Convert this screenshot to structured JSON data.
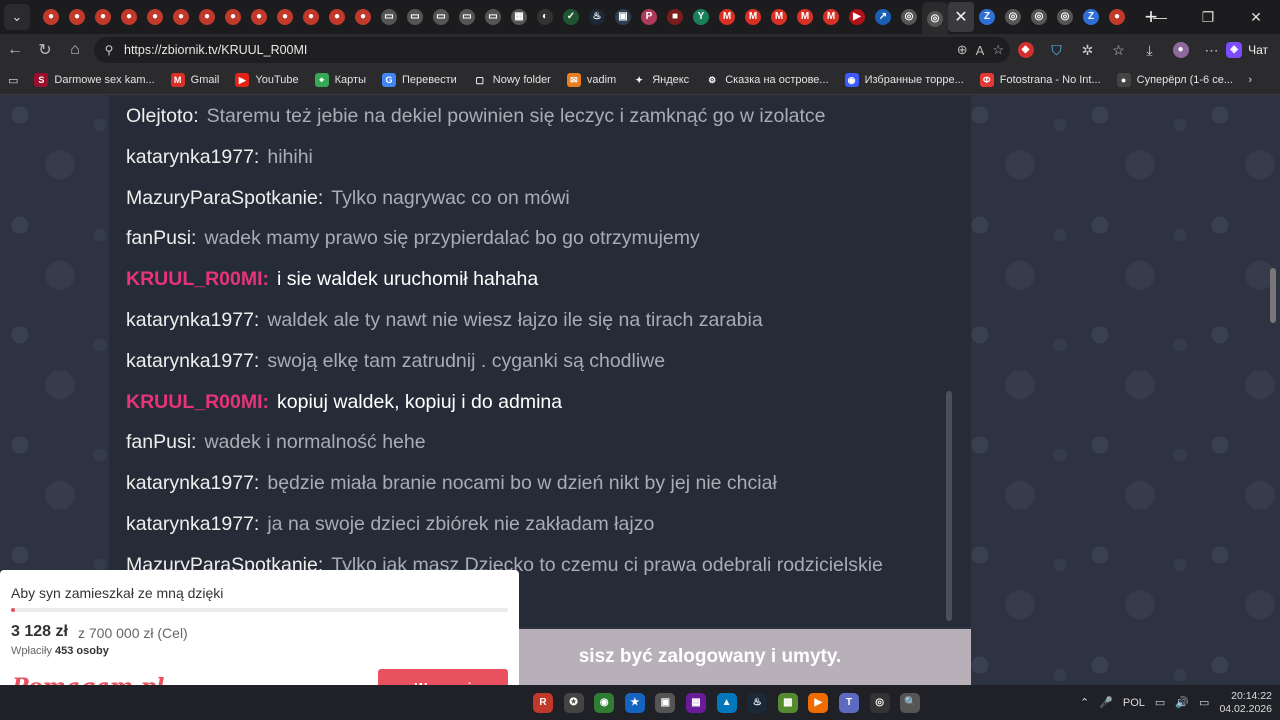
{
  "browser": {
    "tab_favicons": [
      {
        "icon": "cam-icon",
        "color": "#c0392b",
        "glyph": "●"
      },
      {
        "icon": "cam-icon",
        "color": "#c0392b",
        "glyph": "●"
      },
      {
        "icon": "cam-icon",
        "color": "#c0392b",
        "glyph": "●"
      },
      {
        "icon": "cam-icon",
        "color": "#c0392b",
        "glyph": "●"
      },
      {
        "icon": "cam-icon",
        "color": "#c0392b",
        "glyph": "●"
      },
      {
        "icon": "cam-icon",
        "color": "#c0392b",
        "glyph": "●"
      },
      {
        "icon": "cam-icon",
        "color": "#c0392b",
        "glyph": "●"
      },
      {
        "icon": "cam-icon",
        "color": "#c0392b",
        "glyph": "●"
      },
      {
        "icon": "cam-icon",
        "color": "#c0392b",
        "glyph": "●"
      },
      {
        "icon": "cam-icon",
        "color": "#c0392b",
        "glyph": "●"
      },
      {
        "icon": "cam-icon",
        "color": "#c0392b",
        "glyph": "●"
      },
      {
        "icon": "cam-icon",
        "color": "#c0392b",
        "glyph": "●"
      },
      {
        "icon": "cam-icon",
        "color": "#c0392b",
        "glyph": "●"
      },
      {
        "icon": "page-icon",
        "color": "#555",
        "glyph": "▭"
      },
      {
        "icon": "page-icon",
        "color": "#555",
        "glyph": "▭"
      },
      {
        "icon": "page-icon",
        "color": "#555",
        "glyph": "▭"
      },
      {
        "icon": "page-icon",
        "color": "#555",
        "glyph": "▭"
      },
      {
        "icon": "page-icon",
        "color": "#555",
        "glyph": "▭"
      },
      {
        "icon": "chart-icon",
        "color": "#555",
        "glyph": "▦"
      },
      {
        "icon": "globe-icon",
        "color": "#333",
        "glyph": "◐"
      },
      {
        "icon": "leaf-icon",
        "color": "#1e5631",
        "glyph": "✓"
      },
      {
        "icon": "steam-icon",
        "color": "#1b2838",
        "glyph": "♨"
      },
      {
        "icon": "square-icon",
        "color": "#2c3e50",
        "glyph": "▣"
      },
      {
        "icon": "p-icon",
        "color": "#b03a5b",
        "glyph": "P"
      },
      {
        "icon": "tv-icon",
        "color": "#7b1c1c",
        "glyph": "■"
      },
      {
        "icon": "ya-icon",
        "color": "#1b7f5a",
        "glyph": "Y"
      },
      {
        "icon": "gmail-icon",
        "color": "#d93025",
        "glyph": "M"
      },
      {
        "icon": "gmail-icon",
        "color": "#d93025",
        "glyph": "M"
      },
      {
        "icon": "gmail-icon",
        "color": "#d93025",
        "glyph": "M"
      },
      {
        "icon": "gmail-icon",
        "color": "#d93025",
        "glyph": "M"
      },
      {
        "icon": "gmail-icon",
        "color": "#d93025",
        "glyph": "M"
      },
      {
        "icon": "youtube-icon",
        "color": "#b31217",
        "glyph": "▶"
      },
      {
        "icon": "arrow-icon",
        "color": "#1a5fb4",
        "glyph": "↗"
      },
      {
        "icon": "globe-icon",
        "color": "#555",
        "glyph": "◎"
      }
    ],
    "active_tab_favicon": {
      "icon": "globe-icon",
      "color": "#555",
      "glyph": "◎"
    },
    "tab_favicons_after": [
      {
        "icon": "z-icon",
        "color": "#2f6fd6",
        "glyph": "Z"
      },
      {
        "icon": "globe-icon",
        "color": "#555",
        "glyph": "◎"
      },
      {
        "icon": "globe-icon",
        "color": "#555",
        "glyph": "◎"
      },
      {
        "icon": "globe-icon",
        "color": "#555",
        "glyph": "◎"
      },
      {
        "icon": "z-icon",
        "color": "#2f6fd6",
        "glyph": "Z"
      },
      {
        "icon": "cam-icon",
        "color": "#c0392b",
        "glyph": "●"
      }
    ],
    "close_tab_glyph": "✕",
    "new_tab_glyph": "+",
    "window_controls": [
      "—",
      "❐",
      "✕"
    ],
    "url": "https://zbiornik.tv/KRUUL_R00MI",
    "chat_button_label": "Чат"
  },
  "bookmarks": [
    {
      "label": "Darmowe sex kam...",
      "icon": "s-icon",
      "color": "#9b0e2e",
      "glyph": "S"
    },
    {
      "label": "Gmail",
      "icon": "gmail-icon",
      "color": "#d93025",
      "glyph": "M"
    },
    {
      "label": "YouTube",
      "icon": "youtube-icon",
      "color": "#e62117",
      "glyph": "▶"
    },
    {
      "label": "Карты",
      "icon": "map-pin-icon",
      "color": "#34a853",
      "glyph": "⌖"
    },
    {
      "label": "Перевести",
      "icon": "translate-icon",
      "color": "#4285f4",
      "glyph": "G"
    },
    {
      "label": "Nowy folder",
      "icon": "folder-icon",
      "color": "#2b2b2e",
      "glyph": "▢"
    },
    {
      "label": "vadim",
      "icon": "mail-icon",
      "color": "#e67e22",
      "glyph": "✉"
    },
    {
      "label": "Яндекс",
      "icon": "sparkle-icon",
      "color": "#2b2b2e",
      "glyph": "✦"
    },
    {
      "label": "Сказка на острове...",
      "icon": "game-icon",
      "color": "#2b2b2e",
      "glyph": "⚙"
    },
    {
      "label": "Избранные торре...",
      "icon": "torrent-icon",
      "color": "#3d5afe",
      "glyph": "◉"
    },
    {
      "label": "Fotostrana - No Int...",
      "icon": "fotostrana-icon",
      "color": "#e53935",
      "glyph": "Ф"
    },
    {
      "label": "Суперёрл (1-6 се...",
      "icon": "avatar-icon",
      "color": "#444",
      "glyph": "●"
    }
  ],
  "chat": {
    "messages": [
      {
        "user": "Olejtoto:",
        "text": "Staremu też jebie na dekiel powinien się leczyc i zamknąć go w izolatce",
        "own": false
      },
      {
        "user": "katarynka1977:",
        "text": "hihihi",
        "own": false
      },
      {
        "user": "MazuryParaSpotkanie:",
        "text": "Tylko nagrywac co on mówi",
        "own": false
      },
      {
        "user": "fanPusi:",
        "text": "wadek mamy prawo się przypierdalać bo go otrzymujemy",
        "own": false
      },
      {
        "user": "KRUUL_R00MI:",
        "text": "i sie waldek uruchomił hahaha",
        "own": true
      },
      {
        "user": "katarynka1977:",
        "text": "waldek ale ty nawt nie wiesz łajzo ile się na tirach zarabia",
        "own": false
      },
      {
        "user": "katarynka1977:",
        "text": "swoją elkę tam zatrudnij . cyganki są chodliwe",
        "own": false
      },
      {
        "user": "KRUUL_R00MI:",
        "text": "kopiuj waldek, kopiuj i do admina",
        "own": true
      },
      {
        "user": "fanPusi:",
        "text": "wadek i normalność hehe",
        "own": false
      },
      {
        "user": "katarynka1977:",
        "text": "będzie miała branie nocami bo w dzień nikt by jej nie chciał",
        "own": false
      },
      {
        "user": "katarynka1977:",
        "text": "ja na swoje dzieci zbiórek nie zakładam łajzo",
        "own": false
      },
      {
        "user": "MazuryParaSpotkanie:",
        "text": "Tylko jak masz Dziecko to czemu ci prawa odebrali rodzicielskie",
        "own": false
      }
    ],
    "login_notice": "sisz być zalogowany i umyty.",
    "own_color": "#e8337a"
  },
  "popup": {
    "title": "Aby syn zamieszkał ze mną dzięki",
    "amount": "3 128 zł",
    "goal": "z 700 000 zł (Cel)",
    "donors_label": "Wpłaciły",
    "donors_count": "453 osoby",
    "logo": "Pomagam.pl",
    "button": "Wesprzyj",
    "progress_fraction": 0.0045
  },
  "taskbar": {
    "icons": [
      {
        "icon": "r-app-icon",
        "color": "#c0392b",
        "glyph": "R"
      },
      {
        "icon": "compass-icon",
        "color": "#444",
        "glyph": "✪"
      },
      {
        "icon": "chrome-icon",
        "color": "#2e7d32",
        "glyph": "◉"
      },
      {
        "icon": "star-icon",
        "color": "#1565c0",
        "glyph": "★"
      },
      {
        "icon": "box-icon",
        "color": "#555",
        "glyph": "▣"
      },
      {
        "icon": "grid-app-icon",
        "color": "#6a1b9a",
        "glyph": "▦"
      },
      {
        "icon": "photos-icon",
        "color": "#0277bd",
        "glyph": "▲"
      },
      {
        "icon": "steam-icon",
        "color": "#1b2838",
        "glyph": "♨"
      },
      {
        "icon": "puzzle-game-icon",
        "color": "#558b2f",
        "glyph": "▩"
      },
      {
        "icon": "media-player-icon",
        "color": "#ef6c00",
        "glyph": "▶"
      },
      {
        "icon": "teams-icon",
        "color": "#5c6bc0",
        "glyph": "T"
      },
      {
        "icon": "obs-icon",
        "color": "#333",
        "glyph": "◎"
      },
      {
        "icon": "search-app-icon",
        "color": "#555",
        "glyph": "🔍"
      }
    ],
    "language": "POL",
    "time": "20:14:22",
    "date": "04.02.2026"
  }
}
